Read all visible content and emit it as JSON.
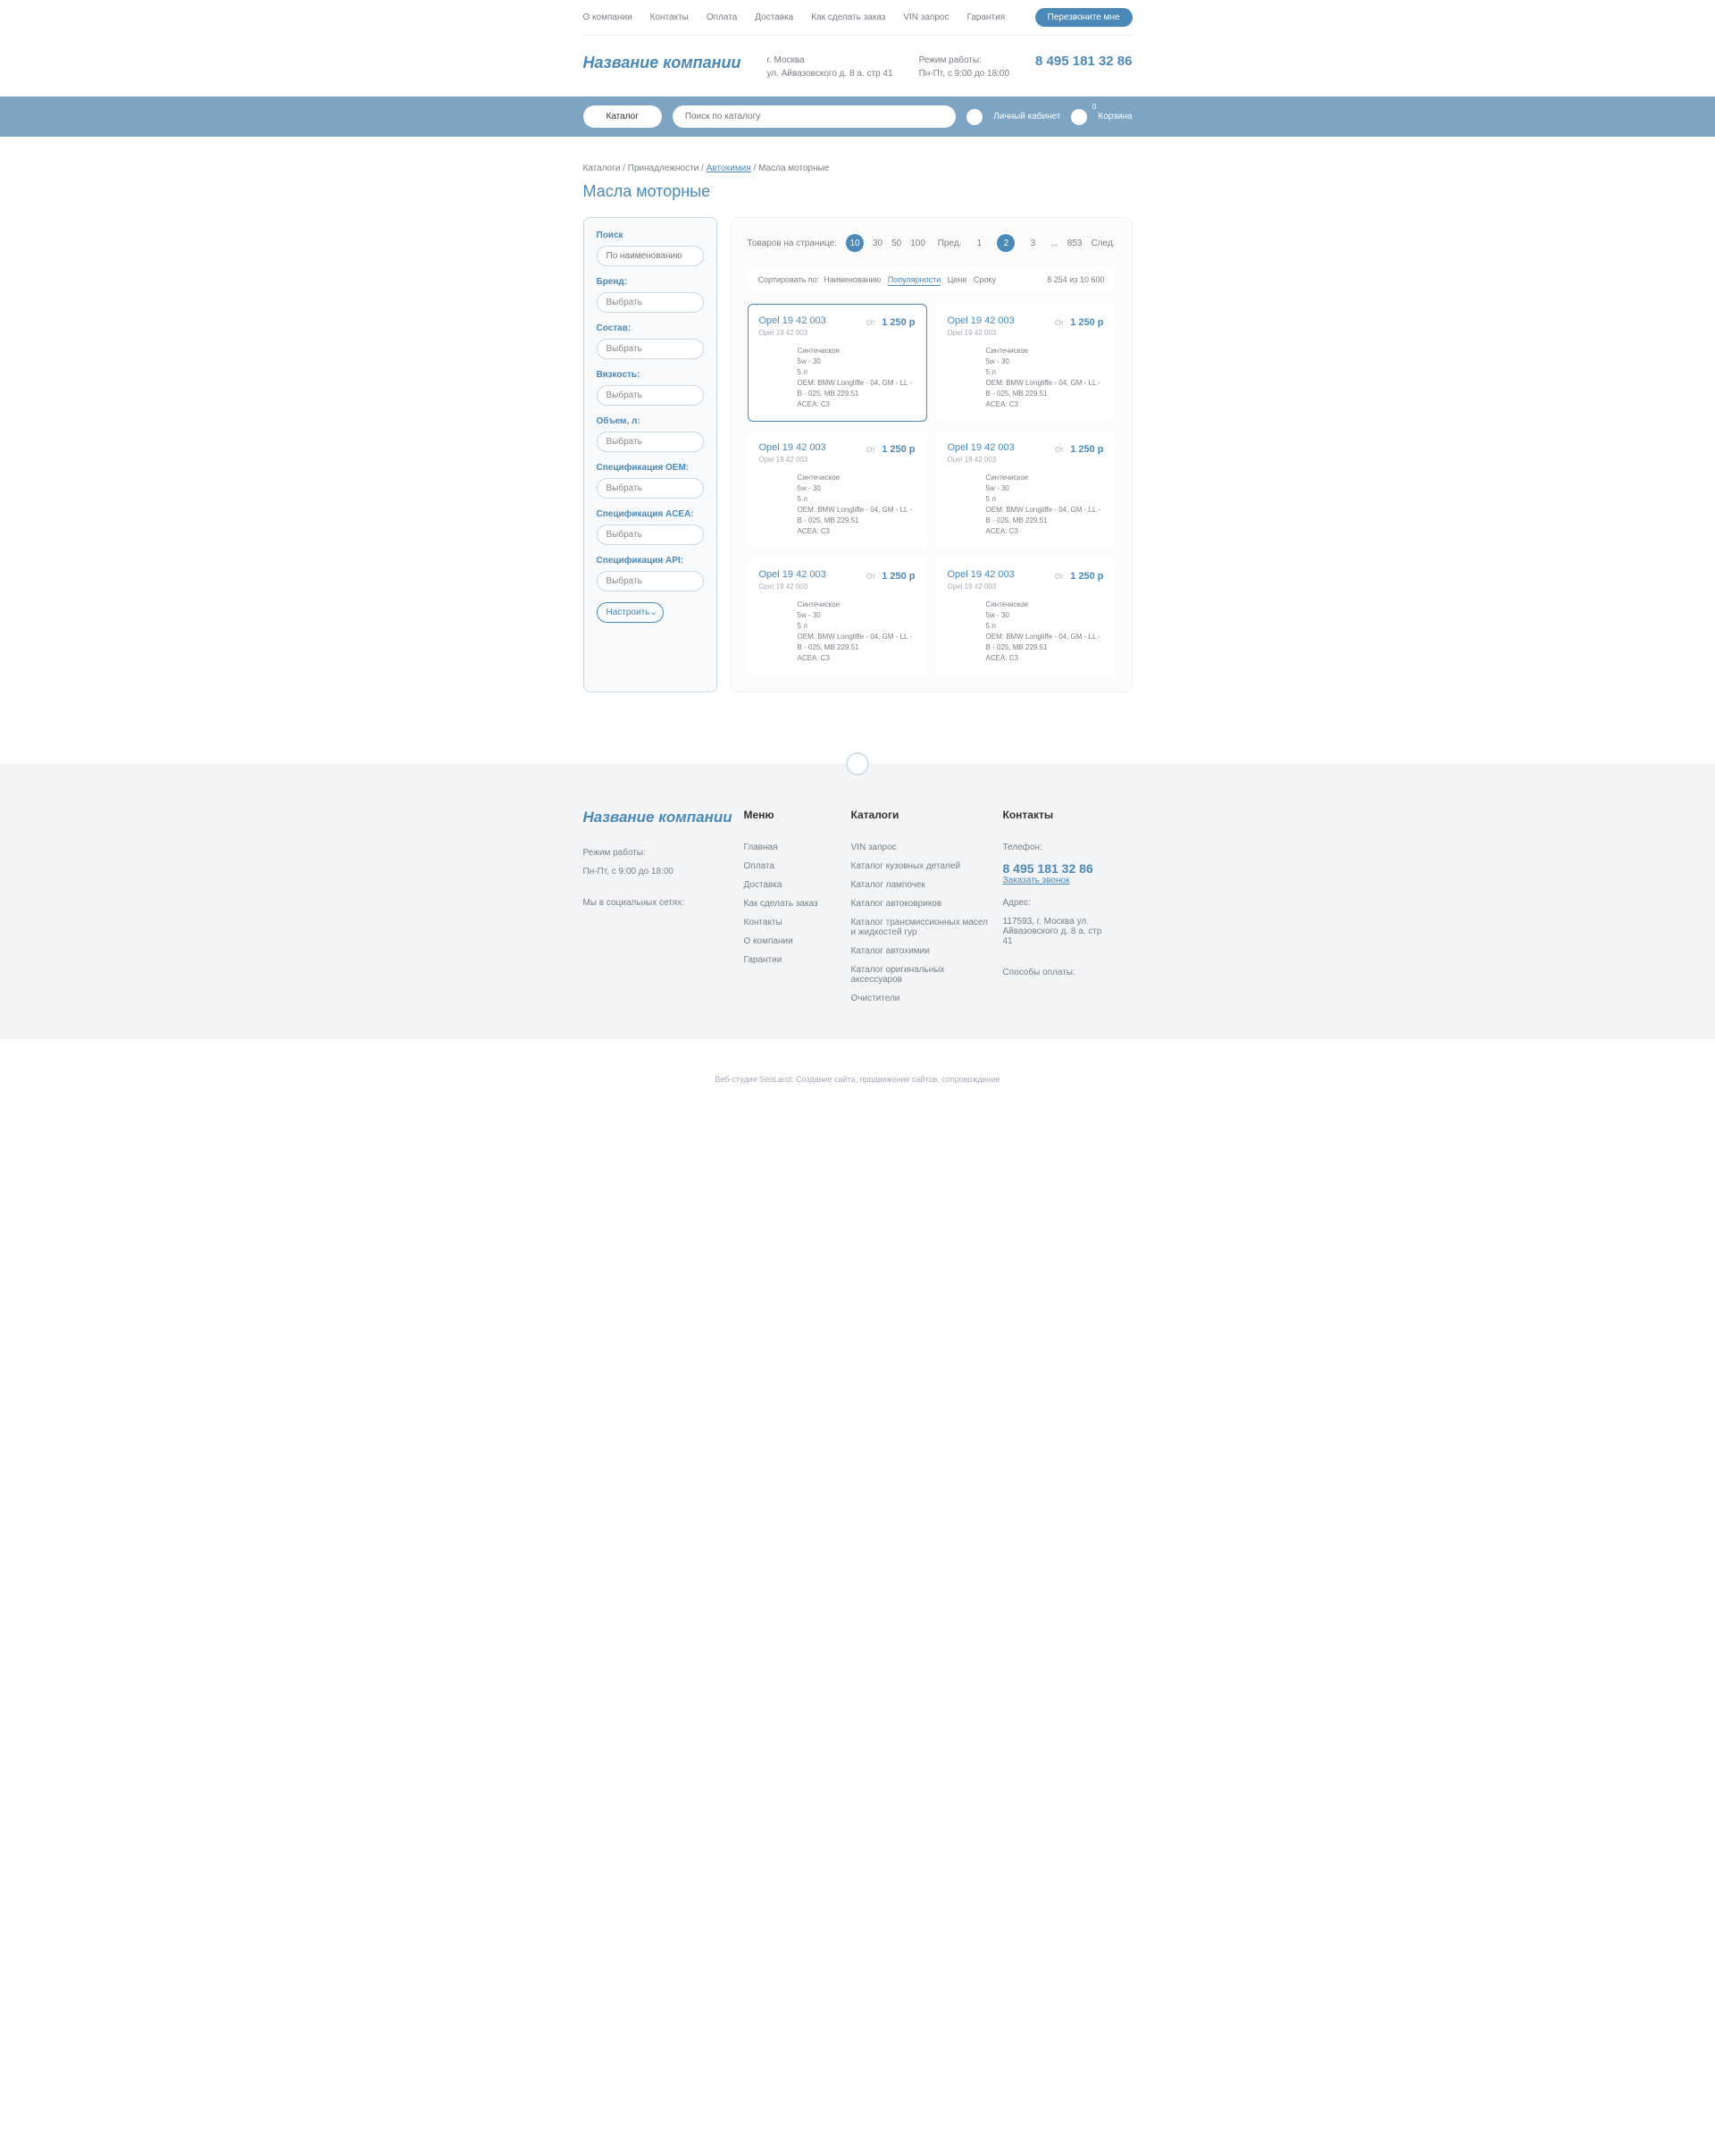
{
  "topnav": {
    "links": [
      "О компании",
      "Контакты",
      "Оплата",
      "Доставка",
      "Как сделать заказ",
      "VIN запрос",
      "Гарантия"
    ],
    "call_btn": "Перезвоните мне"
  },
  "header": {
    "company": "Название компании",
    "city": "г. Москва",
    "address": "ул. Айвазовского д. 8 а. стр 41",
    "hours_label": "Режим работы:",
    "hours": "Пн-Пт, с 9:00 до 18:00",
    "phone": "8 495 181 32 86"
  },
  "bluebar": {
    "catalog_btn": "Каталог",
    "search_placeholder": "Поиск по каталогу",
    "account": "Личный кабинет",
    "cart": "Корзина",
    "cart_count": "0"
  },
  "crumbs": {
    "c1": "Каталоги",
    "c2": "Принадлежности",
    "c3": "Автохимия",
    "c4": "Масла моторные"
  },
  "page_title": "Масла моторные",
  "filter": {
    "search_label": "Поиск",
    "search_placeholder": "По наименованию",
    "groups": [
      {
        "label": "Бренд:",
        "value": "Выбрать"
      },
      {
        "label": "Состав:",
        "value": "Выбрать"
      },
      {
        "label": "Вязкость:",
        "value": "Выбрать"
      },
      {
        "label": "Объем, л:",
        "value": "Выбрать"
      },
      {
        "label": "Спецификация OEM:",
        "value": "Выбрать"
      },
      {
        "label": "Спецификация ACEA:",
        "value": "Выбрать"
      },
      {
        "label": "Спецификация API:",
        "value": "Выбрать"
      }
    ],
    "configure": "Настроить"
  },
  "pager": {
    "per_page_label": "Товаров на странице:",
    "per_page": [
      "10",
      "30",
      "50",
      "100"
    ],
    "prev": "Пред.",
    "pages": [
      "1",
      "2",
      "3"
    ],
    "dots": "...",
    "last": "853",
    "next": "След."
  },
  "sort": {
    "label": "Сортировать по:",
    "opts": [
      "Наименованию",
      "Популярности",
      "Цене",
      "Сроку"
    ],
    "count": "8 254 из 10 600"
  },
  "card": {
    "title": "Opel 19 42 003",
    "sub": "Opel 19 42 003",
    "from": "От",
    "price": "1 250 р",
    "spec1": "Синтечиское",
    "spec2": "5w - 30",
    "spec3": "5 л",
    "spec4": "OEM: BMW Longliffe - 04, GM - LL - B - 025, MB 229.51",
    "spec5": "ACEA: C3"
  },
  "footer": {
    "company": "Название компании",
    "hours_label": "Режим работы:",
    "hours": "Пн-Пт, с 9:00 до 18:00",
    "social": "Мы в социальных сетях:",
    "menu_head": "Меню",
    "menu": [
      "Главная",
      "Оплата",
      "Доставка",
      "Как сделать заказ",
      "Контакты",
      "О компании",
      "Гарантии"
    ],
    "cat_head": "Каталоги",
    "catalogs": [
      "VIN запрос",
      "Каталог кузовных деталей",
      "Каталог лампочек",
      "Каталог автоковриков",
      "Каталог трансмиссионных масел и жидкостей гур",
      "Каталог автохимии",
      "Каталог оригинальных аксессуаров",
      "Очистители"
    ],
    "contacts_head": "Контакты",
    "phone_label": "Телефон:",
    "phone": "8 495 181 32 86",
    "order_call": "Заказать звонок",
    "addr_label": "Адрес:",
    "addr": "117593, г. Москва ул. Айвазовского д. 8 а. стр 41",
    "pay_label": "Способы оплаты:"
  },
  "copyright": "Веб-студия SeoLand: Создание сайта, продвижение сайтов, сопровождение"
}
